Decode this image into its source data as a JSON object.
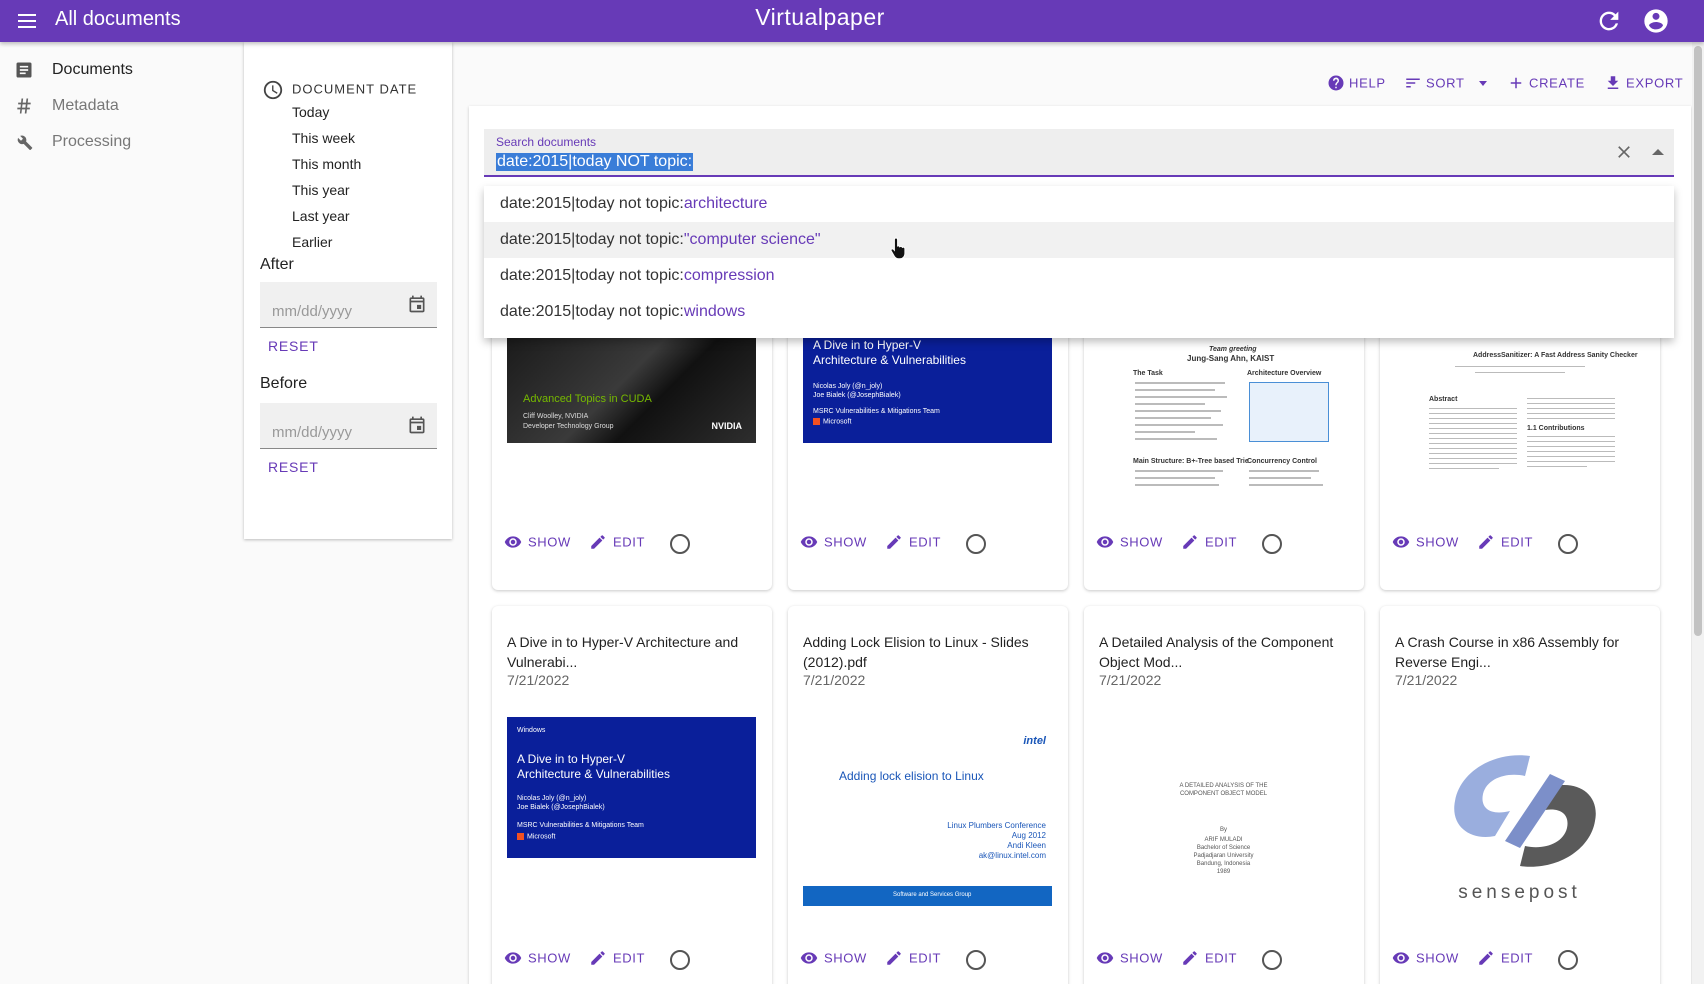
{
  "topbar": {
    "title": "All documents",
    "brand": "Virtualpaper"
  },
  "nav": {
    "items": [
      {
        "label": "Documents",
        "icon": "document-icon"
      },
      {
        "label": "Metadata",
        "icon": "hash-icon"
      },
      {
        "label": "Processing",
        "icon": "tools-icon"
      }
    ]
  },
  "filter": {
    "header": "DOCUMENT DATE",
    "options": [
      "Today",
      "This week",
      "This month",
      "This year",
      "Last year",
      "Earlier"
    ],
    "after_label": "After",
    "before_label": "Before",
    "date_placeholder": "mm/dd/yyyy",
    "reset_label": "RESET"
  },
  "toolbar": {
    "help": "HELP",
    "sort": "SORT",
    "create": "CREATE",
    "export": "EXPORT"
  },
  "search": {
    "label": "Search documents",
    "value": "date:2015|today NOT topic:",
    "suggestion_prefix": "date:2015|today not topic:",
    "suggestions": [
      "architecture",
      "\"computer science\"",
      "compression",
      "windows"
    ]
  },
  "actions": {
    "show": "SHOW",
    "edit": "EDIT"
  },
  "thumbs": {
    "cuda": {
      "heading": "Advanced Topics in CUDA",
      "author": "Cliff Woolley, NVIDIA",
      "group": "Developer Technology Group",
      "logo": "NVIDIA"
    },
    "hyperv": {
      "heading_1": "A Dive in to Hyper-V",
      "heading_2": "Architecture & Vulnerabilities",
      "author_1": "Nicolas Joly (@n_joly)",
      "author_2": "Joe Bialek (@JosephBialek)",
      "team": "MSRC Vulnerabilities & Mitigations Team",
      "brand": "Microsoft",
      "os": "Windows"
    },
    "paper1": {
      "title": "Team greeting",
      "names": "Jung-Sang Ahn, KAIST",
      "task": "The Task",
      "arch": "Architecture Overview",
      "main": "Main Structure: B+-Tree based Trie",
      "cc": "Concurrency Control"
    },
    "paper2": {
      "title": "AddressSanitizer: A Fast Address Sanity Checker",
      "abstract": "Abstract",
      "contrib": "1.1 Contributions"
    },
    "intel": {
      "logo": "intel",
      "heading": "Adding lock elision to Linux",
      "conf": "Linux Plumbers Conference",
      "date": "Aug 2012",
      "author": "Andi Kleen",
      "email": "ak@linux.intel.com",
      "group": "Software and Services Group"
    },
    "com": {
      "l1": "A DETAILED ANALYSIS OF THE",
      "l2": "COMPONENT OBJECT MODEL",
      "l3": "By",
      "l4": "ARIF MULADI",
      "l5": "Bachelor of Science",
      "l6": "Padjadjaran University",
      "l7": "Bandung, Indonesia",
      "l8": "1989"
    },
    "sensepost": {
      "word": "sensepost"
    }
  },
  "documents": [
    {
      "title": "A Dive in to Hyper-V Architecture and Vulnerabi...",
      "date": "7/21/2022"
    },
    {
      "title": "Adding Lock Elision to Linux - Slides (2012).pdf",
      "date": "7/21/2022"
    },
    {
      "title": "A Detailed Analysis of the Component Object Mod...",
      "date": "7/21/2022"
    },
    {
      "title": "A Crash Course in x86 Assembly for Reverse Engi...",
      "date": "7/21/2022"
    }
  ]
}
